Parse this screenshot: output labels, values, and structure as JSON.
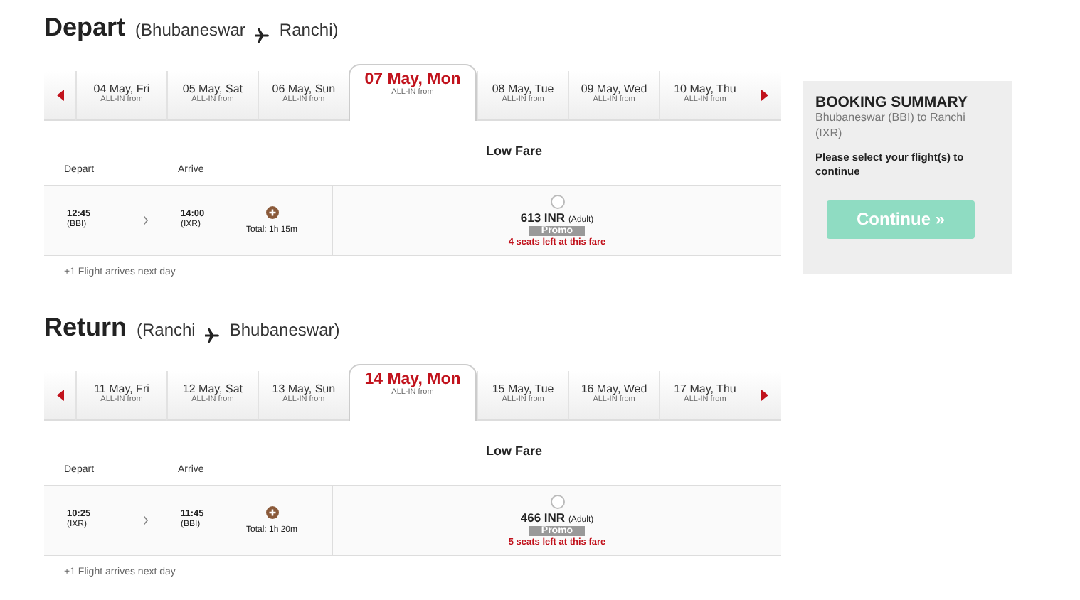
{
  "sections": [
    {
      "title": "Depart",
      "from": "(Bhubaneswar",
      "to": "Ranchi)",
      "dates": [
        {
          "label": "04 May, Fri",
          "sub": "ALL-IN from",
          "selected": false
        },
        {
          "label": "05 May, Sat",
          "sub": "ALL-IN from",
          "selected": false
        },
        {
          "label": "06 May, Sun",
          "sub": "ALL-IN from",
          "selected": false
        },
        {
          "label": "07 May, Mon",
          "sub": "ALL-IN from",
          "selected": true
        },
        {
          "label": "08 May, Tue",
          "sub": "ALL-IN from",
          "selected": false
        },
        {
          "label": "09 May, Wed",
          "sub": "ALL-IN from",
          "selected": false
        },
        {
          "label": "10 May, Thu",
          "sub": "ALL-IN from",
          "selected": false
        }
      ],
      "fare_header": "Low Fare",
      "columns": [
        "Depart",
        "Arrive"
      ],
      "flight": {
        "depart_time": "12:45",
        "depart_code": "(BBI)",
        "arrive_time": "14:00",
        "arrive_code": "(IXR)",
        "total": "Total: 1h 15m",
        "price": "613 INR",
        "pax": "(Adult)",
        "promo": "Promo",
        "seats": "4 seats left at this fare",
        "selected": false
      },
      "note": "+1 Flight arrives next day"
    },
    {
      "title": "Return",
      "from": "(Ranchi",
      "to": "Bhubaneswar)",
      "dates": [
        {
          "label": "11 May, Fri",
          "sub": "ALL-IN from",
          "selected": false
        },
        {
          "label": "12 May, Sat",
          "sub": "ALL-IN from",
          "selected": false
        },
        {
          "label": "13 May, Sun",
          "sub": "ALL-IN from",
          "selected": false
        },
        {
          "label": "14 May, Mon",
          "sub": "ALL-IN from",
          "selected": true
        },
        {
          "label": "15 May, Tue",
          "sub": "ALL-IN from",
          "selected": false
        },
        {
          "label": "16 May, Wed",
          "sub": "ALL-IN from",
          "selected": false
        },
        {
          "label": "17 May, Thu",
          "sub": "ALL-IN from",
          "selected": false
        }
      ],
      "fare_header": "Low Fare",
      "columns": [
        "Depart",
        "Arrive"
      ],
      "flight": {
        "depart_time": "10:25",
        "depart_code": "(IXR)",
        "arrive_time": "11:45",
        "arrive_code": "(BBI)",
        "total": "Total: 1h 20m",
        "price": "466 INR",
        "pax": "(Adult)",
        "promo": "Promo",
        "seats": "5 seats left at this fare",
        "selected": false
      },
      "note": "+1 Flight arrives next day"
    }
  ],
  "summary": {
    "title": "BOOKING SUMMARY",
    "route": "Bhubaneswar (BBI) to Ranchi (IXR)",
    "prompt": "Please select your flight(s) to continue",
    "button": {
      "label": "Continue »",
      "disabled": true
    }
  }
}
